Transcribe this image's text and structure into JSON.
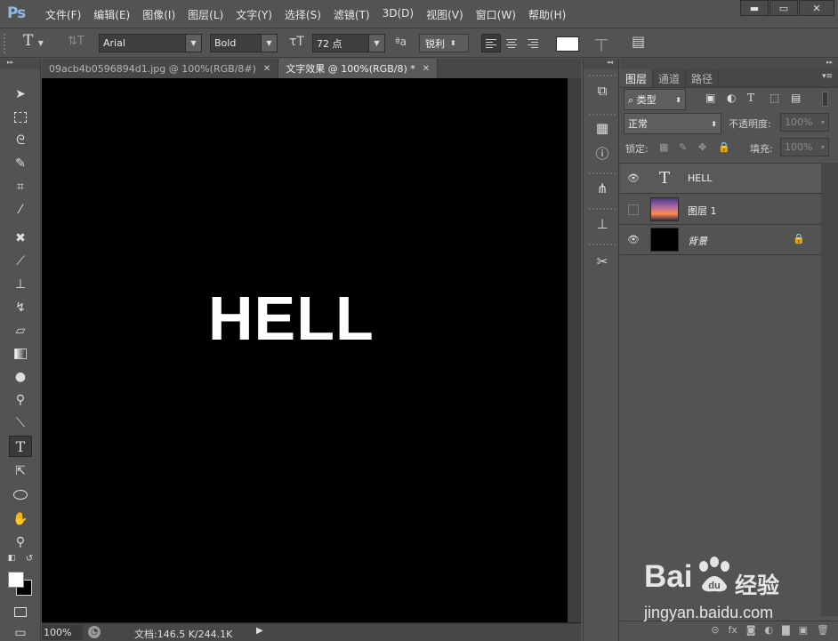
{
  "app": {
    "logo": "Ps",
    "menus": [
      "文件(F)",
      "编辑(E)",
      "图像(I)",
      "图层(L)",
      "文字(Y)",
      "选择(S)",
      "滤镜(T)",
      "3D(D)",
      "视图(V)",
      "窗口(W)",
      "帮助(H)"
    ],
    "window_buttons": {
      "minimize": "▬",
      "maximize": "▭",
      "close": "✕"
    }
  },
  "options": {
    "tool_glyph": "T",
    "orient_glyph": "⇅T",
    "font_family": "Arial",
    "font_style": "Bold",
    "size_glyph": "τT",
    "font_size": "72 点",
    "aa_glyph": "ªa",
    "antialias": "锐利",
    "text_color": "#ffffff",
    "warp_glyph": "丅",
    "panel_glyph": "▤"
  },
  "tabs": [
    {
      "title": "09acb4b0596894d1.jpg @ 100%(RGB/8#)",
      "close": "✕",
      "active": false
    },
    {
      "title": "文字效果 @ 100%(RGB/8) *",
      "close": "✕",
      "active": true
    }
  ],
  "canvas": {
    "text": "HELL",
    "background": "#000000",
    "text_color": "#ffffff"
  },
  "status": {
    "zoom": "100%",
    "doc_size": "文档:146.5 K/244.1K",
    "arrow": "▶"
  },
  "panel": {
    "tabs": [
      "图层",
      "通道",
      "路径"
    ],
    "filter_label": "⌕ 类型",
    "blend_mode": "正常",
    "opacity_label": "不透明度:",
    "opacity_value": "100%",
    "lock_label": "锁定:",
    "fill_label": "填充:",
    "fill_value": "100%",
    "layers": [
      {
        "name": "HELL",
        "visible": true,
        "type": "text",
        "thumb_glyph": "T"
      },
      {
        "name": "图层 1",
        "visible": false,
        "type": "image"
      },
      {
        "name": "背景",
        "visible": true,
        "type": "background",
        "locked": true
      }
    ],
    "footer_icons": [
      "⊝",
      "fx",
      "◙",
      "◐",
      "▇",
      "▣",
      "🗑"
    ]
  },
  "watermark": {
    "brand": "Bai",
    "brand_tail": "du",
    "cn": "经验",
    "url": "jingyan.baidu.com"
  }
}
